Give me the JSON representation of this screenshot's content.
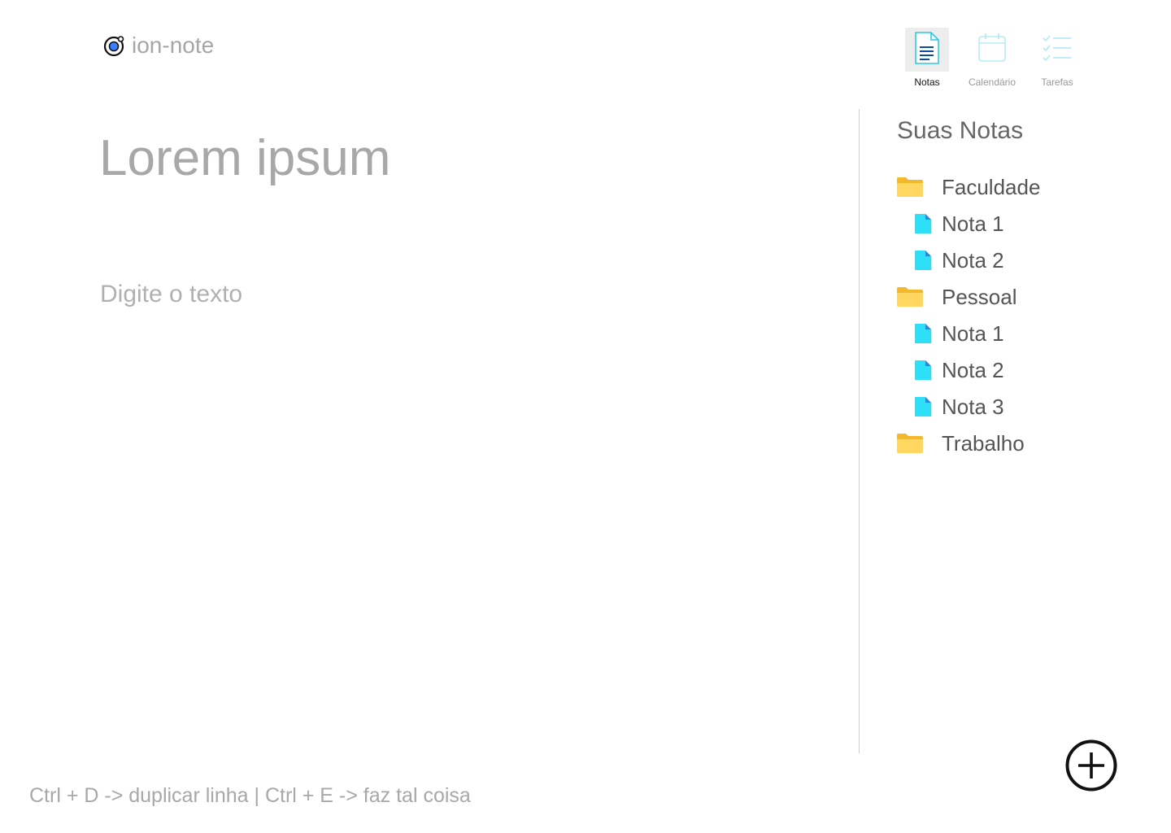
{
  "app": {
    "name": "ion-note"
  },
  "nav": {
    "items": [
      {
        "label": "Notas",
        "icon": "document-icon",
        "active": true
      },
      {
        "label": "Calendário",
        "icon": "calendar-icon",
        "active": false
      },
      {
        "label": "Tarefas",
        "icon": "checklist-icon",
        "active": false
      }
    ]
  },
  "editor": {
    "title": "Lorem ipsum",
    "body_placeholder": "Digite o texto"
  },
  "sidebar": {
    "title": "Suas Notas",
    "tree": [
      {
        "type": "folder",
        "label": "Faculdade",
        "icon": "folder-icon"
      },
      {
        "type": "note",
        "label": "Nota 1",
        "icon": "note-file-icon"
      },
      {
        "type": "note",
        "label": "Nota 2",
        "icon": "note-file-icon"
      },
      {
        "type": "folder",
        "label": "Pessoal",
        "icon": "folder-icon"
      },
      {
        "type": "note",
        "label": "Nota 1",
        "icon": "note-file-icon"
      },
      {
        "type": "note",
        "label": "Nota 2",
        "icon": "note-file-icon"
      },
      {
        "type": "note",
        "label": "Nota 3",
        "icon": "note-file-icon"
      },
      {
        "type": "folder",
        "label": "Trabalho",
        "icon": "folder-icon"
      }
    ]
  },
  "footer": {
    "shortcuts": "Ctrl + D -> duplicar linha | Ctrl + E -> faz tal coisa"
  },
  "actions": {
    "add_icon": "add-circle-icon"
  },
  "colors": {
    "folder": "#f7c948",
    "note": "#2ee0f7",
    "note_fold": "#1d8fe0",
    "nav_icon": "#b8ecf5",
    "logo_accent": "#3880ff"
  }
}
